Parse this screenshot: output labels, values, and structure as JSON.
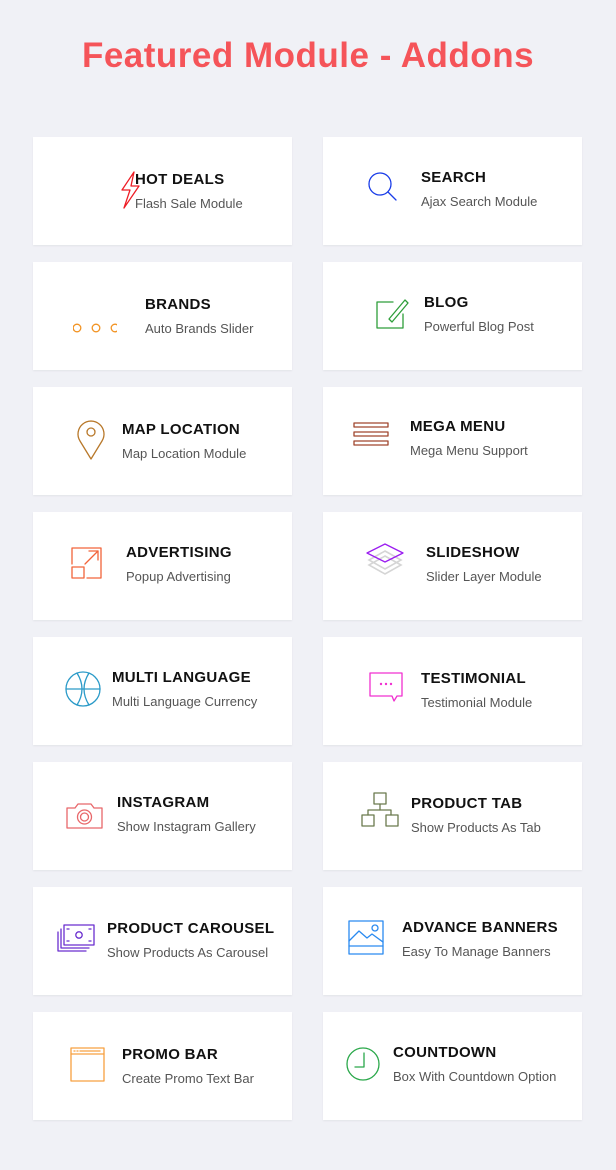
{
  "title": "Featured Module - Addons",
  "modules": [
    {
      "name": "HOT DEALS",
      "desc": "Flash Sale Module",
      "icon": "lightning-icon",
      "color": "#ee1c25"
    },
    {
      "name": "SEARCH",
      "desc": "Ajax Search Module",
      "icon": "search-icon",
      "color": "#1a3de8"
    },
    {
      "name": "BRANDS",
      "desc": "Auto Brands Slider",
      "icon": "dots-icon",
      "color": "#f29322"
    },
    {
      "name": "BLOG",
      "desc": "Powerful Blog Post",
      "icon": "edit-icon",
      "color": "#2e9e3a"
    },
    {
      "name": "MAP LOCATION",
      "desc": "Map Location Module",
      "icon": "map-pin-icon",
      "color": "#b8782a"
    },
    {
      "name": "MEGA MENU",
      "desc": "Mega Menu Support",
      "icon": "menu-icon",
      "color": "#a0462e"
    },
    {
      "name": "ADVERTISING",
      "desc": "Popup Advertising",
      "icon": "expand-icon",
      "color": "#f2643a"
    },
    {
      "name": "SLIDESHOW",
      "desc": "Slider Layer Module",
      "icon": "layers-icon",
      "color": "#9b1df0"
    },
    {
      "name": "MULTI LANGUAGE",
      "desc": "Multi Language Currency",
      "icon": "globe-icon",
      "color": "#2a9ac8"
    },
    {
      "name": "TESTIMONIAL",
      "desc": "Testimonial Module",
      "icon": "chat-bubble-icon",
      "color": "#f030d0"
    },
    {
      "name": "INSTAGRAM",
      "desc": "Show Instagram Gallery",
      "icon": "camera-icon",
      "color": "#e8676a"
    },
    {
      "name": "PRODUCT TAB",
      "desc": "Show Products As Tab",
      "icon": "sitemap-icon",
      "color": "#6b7a4e"
    },
    {
      "name": "PRODUCT CAROUSEL",
      "desc": "Show Products As Carousel",
      "icon": "money-stack-icon",
      "color": "#6a2ecf"
    },
    {
      "name": "ADVANCE BANNERS",
      "desc": "Easy To Manage Banners",
      "icon": "image-icon",
      "color": "#2a8af0"
    },
    {
      "name": "PROMO BAR",
      "desc": "Create Promo Text Bar",
      "icon": "browser-window-icon",
      "color": "#f7a040"
    },
    {
      "name": "COUNTDOWN",
      "desc": "Box With Countdown Option",
      "icon": "clock-icon",
      "color": "#2aa84a"
    }
  ]
}
